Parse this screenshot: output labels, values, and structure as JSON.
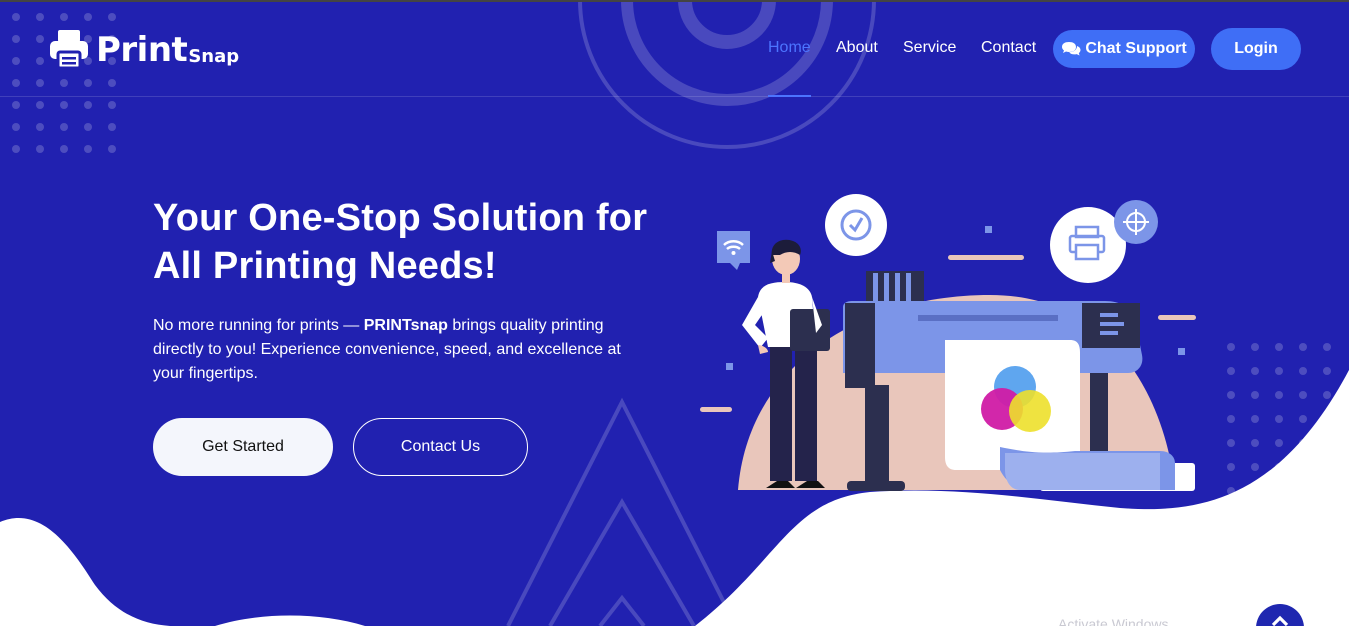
{
  "brand": {
    "name_main": "Print",
    "name_sub": "Snap",
    "logo_icon": "printer-icon"
  },
  "nav": {
    "links": [
      {
        "label": "Home",
        "active": true
      },
      {
        "label": "About",
        "active": false
      },
      {
        "label": "Service",
        "active": false
      },
      {
        "label": "Contact",
        "active": false
      }
    ],
    "chat_support": {
      "label": "Chat Support",
      "icon": "chat-bubbles-icon"
    },
    "login_label": "Login"
  },
  "hero": {
    "headline": "Your One-Stop Solution for All Printing Needs!",
    "desc_before": "No more running for prints — ",
    "desc_brand": "PRINTsnap",
    "desc_after": " brings quality printing directly to you! Experience convenience, speed, and excellence at your fingertips.",
    "primary_button": "Get Started",
    "secondary_button": "Contact Us"
  },
  "scroll_top": {
    "icon": "chevron-up-icon"
  },
  "watermark": "Activate Windows",
  "colors": {
    "background": "#2121b0",
    "accent": "#3f6ef6",
    "active_link": "#4c74ff",
    "white": "#ffffff"
  }
}
